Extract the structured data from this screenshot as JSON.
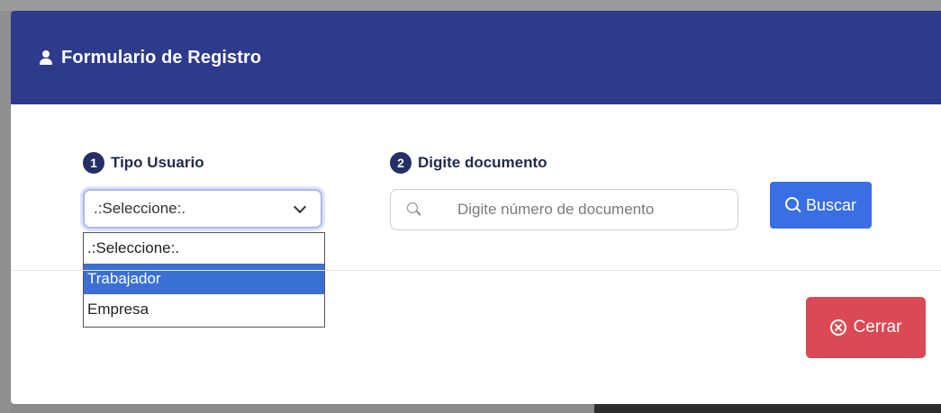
{
  "modal": {
    "title": "Formulario de Registro",
    "header_icon": "user-icon",
    "header_color": "#2e3a8c"
  },
  "step1": {
    "number": "1",
    "label": "Tipo Usuario",
    "select_value": ".:Seleccione:.",
    "options": [
      ".:Seleccione:.",
      "Trabajador",
      "Empresa"
    ],
    "highlighted_option": "Trabajador"
  },
  "step2": {
    "number": "2",
    "label": "Digite documento",
    "input_value": "",
    "placeholder": "Digite número de documento"
  },
  "buttons": {
    "search_label": "Buscar",
    "search_color": "#3a6fe3",
    "close_label": "Cerrar",
    "close_color": "#d94a55"
  }
}
